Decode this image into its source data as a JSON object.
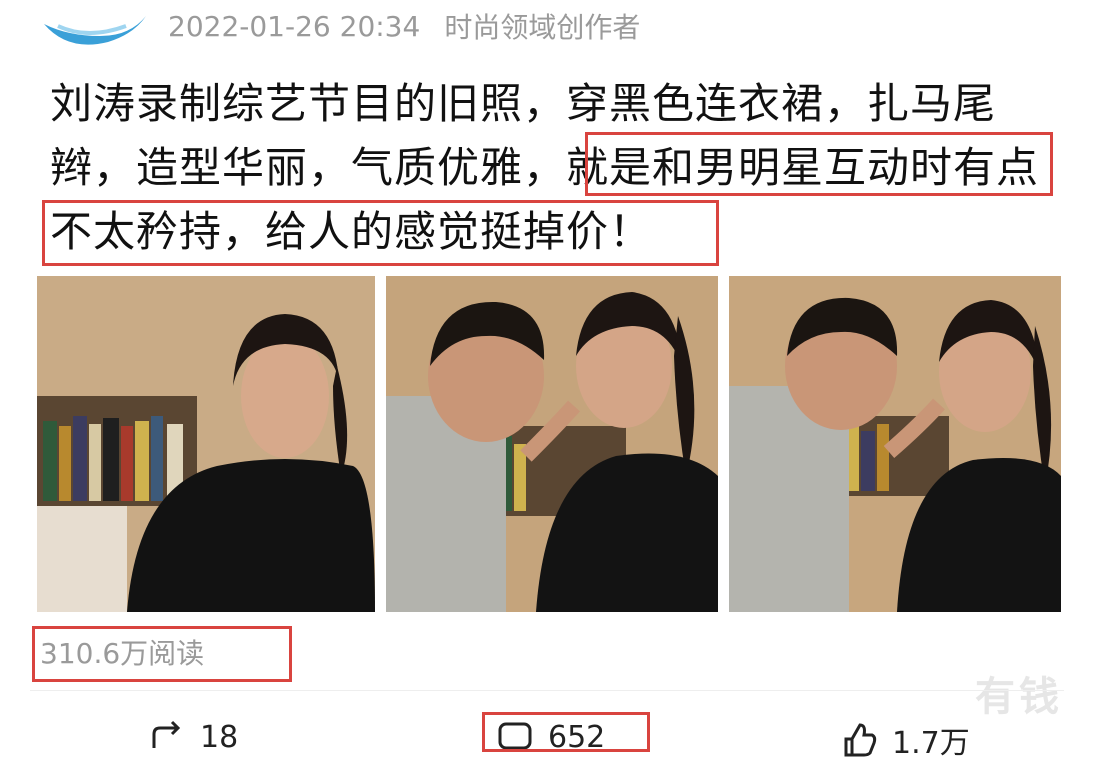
{
  "header": {
    "timestamp": "2022-01-26 20:34",
    "author_role": "时尚领域创作者"
  },
  "post": {
    "text_part1": "刘涛录制综艺节目的旧照，穿黑色连衣裙，扎马尾辫，造型华丽，气质优雅，",
    "text_part2": "就是和男明星互动时有点不太矜持，给人的感觉挺掉价！"
  },
  "stats": {
    "reads": "310.6万阅读"
  },
  "watermark": "有钱",
  "actions": {
    "share_count": "18",
    "comment_count": "652",
    "like_count": "1.7万"
  },
  "colors": {
    "highlight": "#d9443f",
    "meta_gray": "#9a9a9a",
    "avatar_blue": "#3aa0d8"
  },
  "icons": [
    "avatar-logo",
    "share-icon",
    "comment-icon",
    "like-icon"
  ]
}
